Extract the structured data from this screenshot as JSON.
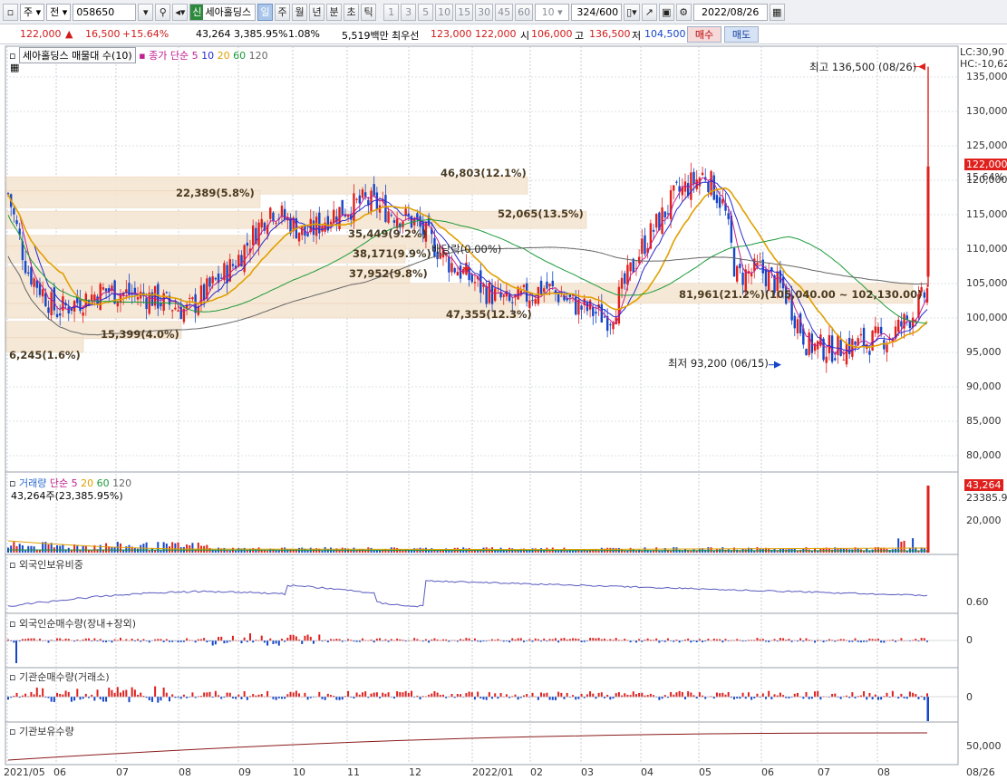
{
  "toolbar": {
    "market": "주",
    "prev": "전",
    "code": "058650",
    "name_badge": "신",
    "name": "세아홀딩스",
    "periods": [
      "일",
      "주",
      "월",
      "년",
      "분",
      "초",
      "틱"
    ],
    "active_period": "일",
    "intervals": [
      "1",
      "3",
      "5",
      "10",
      "15",
      "30",
      "45",
      "60"
    ],
    "interval_select": "10",
    "count": "324",
    "max": "/600",
    "date": "2022/08/26"
  },
  "quote": {
    "price": "122,000",
    "arrow": "▲",
    "change": "16,500",
    "change_pct": "+15.64%",
    "volume": "43,264",
    "volume_pct": "3,385.95%",
    "turnover": "1.08%",
    "amount": "5,519백만",
    "best_label": "최우선",
    "ask": "123,000",
    "bid": "122,000",
    "open_label": "시",
    "open": "106,000",
    "high_label": "고",
    "high": "136,500",
    "low_label": "저",
    "low": "104,500",
    "buy": "매수",
    "sell": "매도"
  },
  "price_panel": {
    "legend_box": "세아홀딩스 매물대 수(10)",
    "ma_label": "종가 단순",
    "ma_periods": [
      "5",
      "10",
      "20",
      "60",
      "120"
    ],
    "ma_colors": [
      "#2a2ad0",
      "#2a2ad0",
      "#e0a000",
      "#1d9a3a",
      "#666666"
    ],
    "lc": "LC:30,90",
    "hc": "HC:-10,62",
    "current_price_tag": "122,000",
    "current_pct_tag": "15.64%",
    "high_note": "최고 136,500 (08/26)",
    "low_note": "최저 93,200 (06/15)",
    "dividend_note": "배당락(0.00%)",
    "y_ticks": [
      "135,000",
      "130,000",
      "125,000",
      "120,000",
      "115,000",
      "110,000",
      "105,000",
      "100,000",
      "95,000",
      "90,000",
      "85,000",
      "80,000"
    ],
    "volume_profile": [
      {
        "label": "46,803(12.1%)"
      },
      {
        "label": "22,389(5.8%)"
      },
      {
        "label": "52,065(13.5%)"
      },
      {
        "label": "37,952(9.8%)"
      },
      {
        "label": "47,355(12.3%)"
      },
      {
        "label": "81,961(21.2%)(105,040.00 ~ 102,130.00)"
      },
      {
        "label": "15,399(4.0%)"
      },
      {
        "label": "6,245(1.6%)"
      },
      {
        "label": "35,449(9.2%)"
      },
      {
        "label": "38,171(9.9%)"
      }
    ]
  },
  "volume_panel": {
    "title": "거래량",
    "ma_label": "단순",
    "ma_periods": [
      "5",
      "20",
      "60",
      "120"
    ],
    "summary": "43,264주(23,385.95%)",
    "tag_value": "43,264",
    "tag_pct": "23385.95",
    "y_tick": "20,000"
  },
  "foreign_ratio_panel": {
    "title": "외국인보유비중",
    "y_tick": "0.60"
  },
  "foreign_net_panel": {
    "title": "외국인순매수량(장내+장외)",
    "y_tick": "0"
  },
  "inst_net_panel": {
    "title": "기관순매수량(거래소)",
    "y_tick": "0"
  },
  "inst_hold_panel": {
    "title": "기관보유수량",
    "y_tick": "50,000"
  },
  "x_axis": [
    "2021/05",
    "06",
    "07",
    "08",
    "09",
    "10",
    "11",
    "12",
    "2022/01",
    "02",
    "03",
    "04",
    "05",
    "06",
    "07",
    "08",
    "08/26"
  ]
}
